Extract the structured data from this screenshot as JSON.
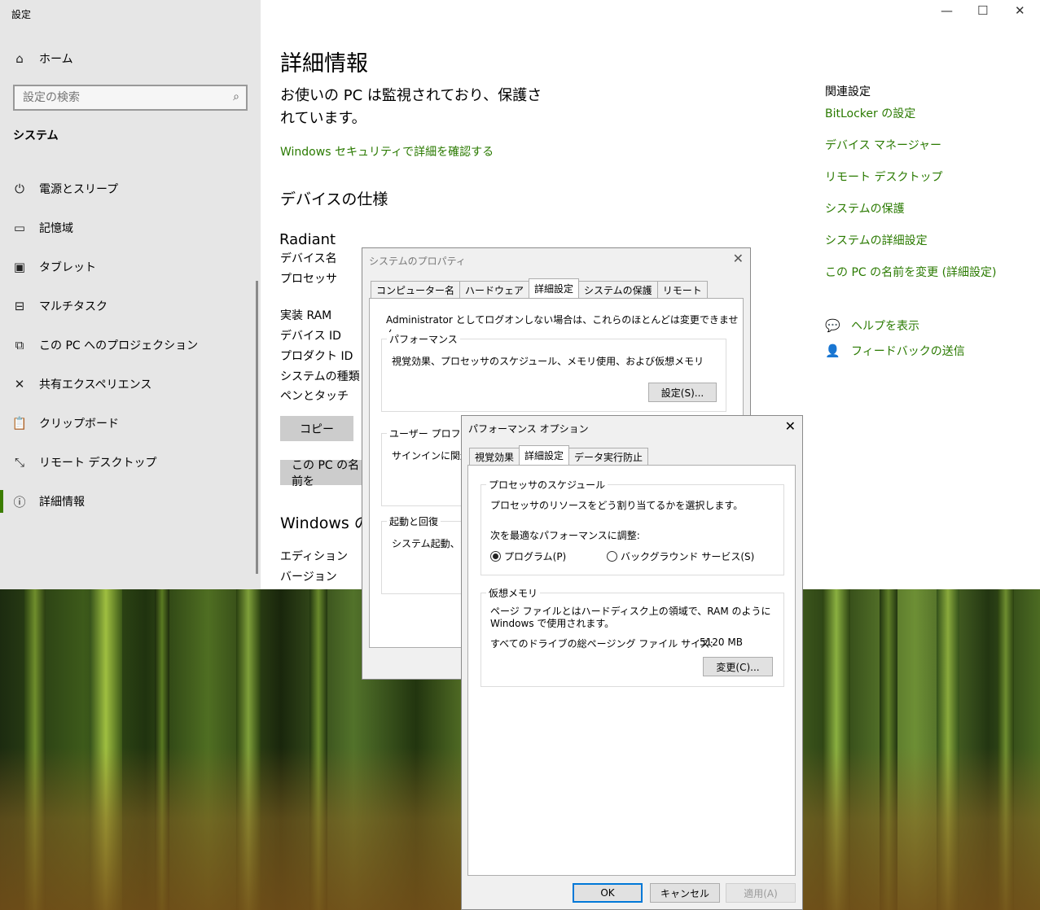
{
  "settings": {
    "window_title": "設定",
    "home": "ホーム",
    "search_placeholder": "設定の検索",
    "group": "システム",
    "nav": [
      {
        "label": "電源とスリープ",
        "icon": "power-icon"
      },
      {
        "label": "記憶域",
        "icon": "storage-icon"
      },
      {
        "label": "タブレット",
        "icon": "tablet-icon"
      },
      {
        "label": "マルチタスク",
        "icon": "multitask-icon"
      },
      {
        "label": "この PC へのプロジェクション",
        "icon": "projection-icon"
      },
      {
        "label": "共有エクスペリエンス",
        "icon": "shared-experience-icon"
      },
      {
        "label": "クリップボード",
        "icon": "clipboard-icon"
      },
      {
        "label": "リモート デスクトップ",
        "icon": "remote-desktop-icon"
      },
      {
        "label": "詳細情報",
        "icon": "info-icon"
      }
    ],
    "accent": "#3b7d00"
  },
  "about": {
    "title": "詳細情報",
    "status": "お使いの PC は監視されており、保護されています。",
    "security_link": "Windows セキュリティで詳細を確認する",
    "device_specs_heading": "デバイスの仕様",
    "device_name": "Radiant",
    "spec_labels": [
      "デバイス名",
      "プロセッサ",
      "実装 RAM",
      "デバイス ID",
      "プロダクト ID",
      "システムの種類",
      "ペンとタッチ"
    ],
    "copy_button": "コピー",
    "rename_button": "この PC の名前を",
    "windows_heading": "Windows の",
    "windows_labels": [
      "エディション",
      "バージョン"
    ]
  },
  "related": {
    "heading": "関連設定",
    "links": [
      "BitLocker の設定",
      "デバイス マネージャー",
      "リモート デスクトップ",
      "システムの保護",
      "システムの詳細設定",
      "この PC の名前を変更 (詳細設定)"
    ],
    "help": "ヘルプを表示",
    "feedback": "フィードバックの送信"
  },
  "sysprops": {
    "title": "システムのプロパティ",
    "tabs": [
      "コンピューター名",
      "ハードウェア",
      "詳細設定",
      "システムの保護",
      "リモート"
    ],
    "selected_tab": "詳細設定",
    "admin_note": "Administrator としてログオンしない場合は、これらのほとんどは変更できません。",
    "perf_legend": "パフォーマンス",
    "perf_desc": "視覚効果、プロセッサのスケジュール、メモリ使用、および仮想メモリ",
    "perf_button": "設定(S)...",
    "profile_legend": "ユーザー プロファイル",
    "profile_desc": "サインインに関連し",
    "startup_legend": "起動と回復",
    "startup_desc": "システム起動、シス"
  },
  "perfopts": {
    "title": "パフォーマンス オプション",
    "tabs": [
      "視覚効果",
      "詳細設定",
      "データ実行防止"
    ],
    "selected_tab": "詳細設定",
    "sched_legend": "プロセッサのスケジュール",
    "sched_desc": "プロセッサのリソースをどう割り当てるかを選択します。",
    "adjust_label": "次を最適なパフォーマンスに調整:",
    "radio_program": "プログラム(P)",
    "radio_background": "バックグラウンド サービス(S)",
    "selected_radio": "program",
    "vm_legend": "仮想メモリ",
    "vm_desc": "ページ ファイルとはハードディスク上の領域で、RAM のように Windows で使用されます。",
    "vm_total_label": "すべてのドライブの総ページング ファイル サイズ:",
    "vm_total_value": "5120 MB",
    "change_button": "変更(C)...",
    "ok": "OK",
    "cancel": "キャンセル",
    "apply": "適用(A)"
  }
}
